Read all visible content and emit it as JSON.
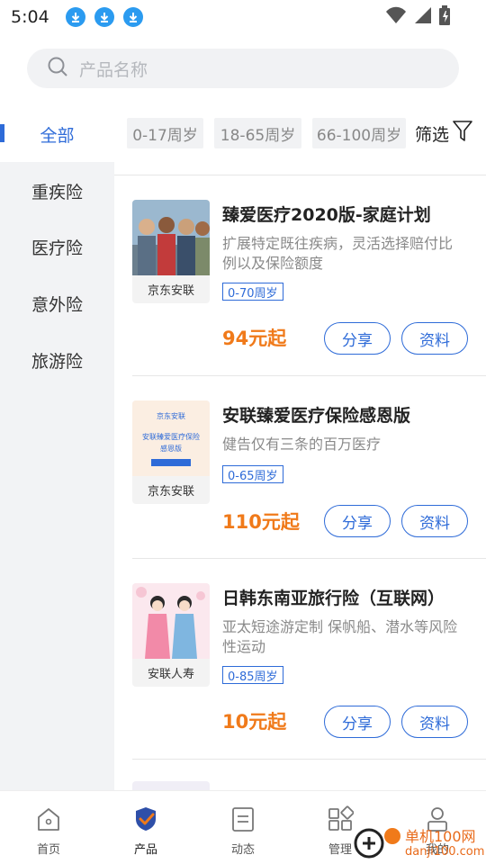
{
  "status_bar": {
    "time": "5:04"
  },
  "search": {
    "placeholder": "产品名称"
  },
  "sidebar": {
    "items": [
      {
        "label": "全部",
        "active": true
      },
      {
        "label": "重疾险"
      },
      {
        "label": "医疗险"
      },
      {
        "label": "意外险"
      },
      {
        "label": "旅游险"
      }
    ]
  },
  "filters": {
    "chips": [
      "0-17周岁",
      "18-65周岁",
      "66-100周岁"
    ],
    "filter_label": "筛选"
  },
  "products": [
    {
      "title": "臻爱医疗2020版-家庭计划",
      "desc": "扩展特定既往疾病，灵活选择赔付比例以及保险额度",
      "provider": "京东安联",
      "age": "0-70周岁",
      "price": "94元起",
      "share": "分享",
      "info": "资料"
    },
    {
      "title": "安联臻爱医疗保险感恩版",
      "desc": "健告仅有三条的百万医疗",
      "provider": "京东安联",
      "age": "0-65周岁",
      "price": "110元起",
      "share": "分享",
      "info": "资料",
      "thumb_text": {
        "brand": "京东安联",
        "line1": "安联臻爱医疗保险",
        "line2": "感恩版"
      }
    },
    {
      "title": "日韩东南亚旅行险（互联网）",
      "desc": "亚太短途游定制 保帆船、潜水等风险性运动",
      "provider": "安联人寿",
      "age": "0-85周岁",
      "price": "10元起",
      "share": "分享",
      "info": "资料"
    }
  ],
  "tab_bar": {
    "items": [
      {
        "label": "首页",
        "icon": "home-icon"
      },
      {
        "label": "产品",
        "icon": "shield-check-icon",
        "active": true
      },
      {
        "label": "动态",
        "icon": "document-icon"
      },
      {
        "label": "管理",
        "icon": "grid-icon"
      },
      {
        "label": "我的",
        "icon": "user-icon"
      }
    ]
  },
  "watermark": {
    "line1": "单机100网",
    "line2": "danji100.com"
  },
  "colors": {
    "accent": "#2e6bd8",
    "price": "#f07a1a",
    "sidebar_bg": "#f2f3f5"
  }
}
